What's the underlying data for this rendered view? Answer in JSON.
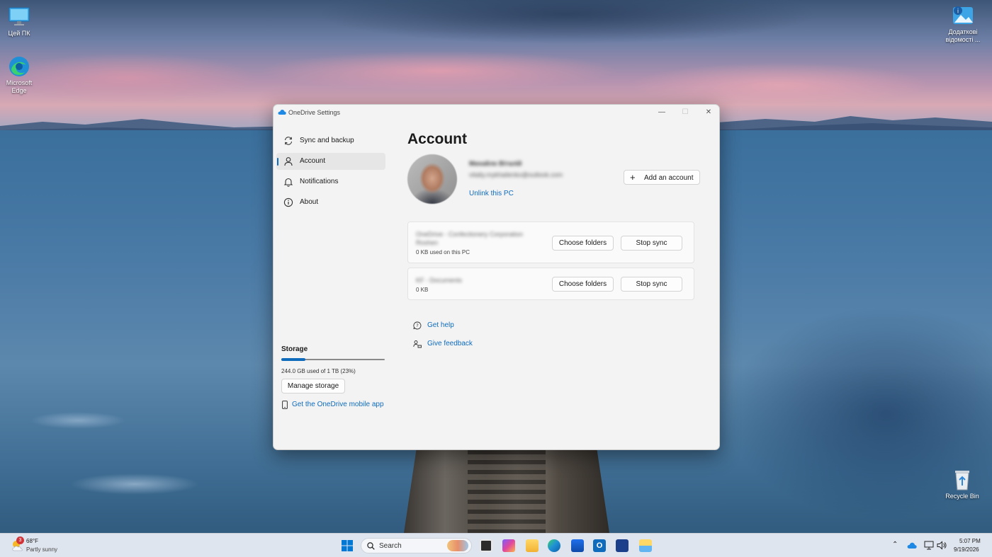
{
  "desktop": {
    "icons": [
      {
        "label": "Цей ПК"
      },
      {
        "label": "Microsoft Edge"
      },
      {
        "label": "Додаткові відомості ..."
      },
      {
        "label": "Recycle Bin"
      }
    ]
  },
  "window": {
    "title": "OneDrive Settings",
    "controls": {
      "minimize": "—",
      "maximize": "☐",
      "close": "✕"
    }
  },
  "nav": {
    "items": [
      {
        "label": "Sync and backup",
        "icon": "sync-icon"
      },
      {
        "label": "Account",
        "icon": "person-icon"
      },
      {
        "label": "Notifications",
        "icon": "bell-icon"
      },
      {
        "label": "About",
        "icon": "info-icon"
      }
    ],
    "active": "Account"
  },
  "storage": {
    "heading": "Storage",
    "used_fraction": 0.23,
    "summary": "244.0 GB used of 1 TB (23%)",
    "manage_label": "Manage storage",
    "mobile_app_link": "Get the OneDrive mobile app"
  },
  "account": {
    "heading": "Account",
    "name": "Михайло Віталій",
    "email": "vitaliy.mykhailenko@outlook.com",
    "unlink_label": "Unlink this PC",
    "add_account_label": "Add an account"
  },
  "sync_items": [
    {
      "name_line1": "OneDrive - Confectionery Corporation",
      "name_line2": "Roshen",
      "info": "0 KB used on this PC",
      "choose_label": "Choose folders",
      "stop_label": "Stop sync"
    },
    {
      "name_line1": "KF - Documents",
      "info": "0 KB",
      "choose_label": "Choose folders",
      "stop_label": "Stop sync"
    }
  ],
  "help_links": {
    "get_help": "Get help",
    "give_feedback": "Give feedback"
  },
  "taskbar": {
    "weather_temp": "68°F",
    "weather_desc": "Partly sunny",
    "weather_badge": "3",
    "search_placeholder": "Search",
    "time": "5:07 PM",
    "date": "9/19/2026"
  },
  "colors": {
    "accent": "#0f6cbd",
    "window_bg": "#f3f3f3",
    "taskbar_bg": "#dfe5ee"
  }
}
